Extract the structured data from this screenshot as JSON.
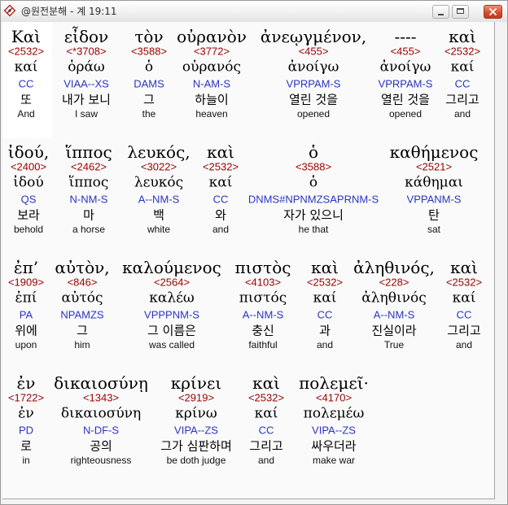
{
  "window": {
    "title": "@원전분해 - 계 19:11",
    "icon": "app-icon",
    "controls": {
      "minimize_icon": "minimize-icon",
      "maximize_icon": "maximize-icon",
      "close_icon": "close-icon"
    }
  },
  "colors": {
    "greek": "#000000",
    "strong": "#9a0000",
    "lemma": "#000000",
    "parse": "#2a35c0",
    "korean": "#000000",
    "english": "#111111",
    "close_button": "#d5492c",
    "selected_word_background": "#ffffff",
    "content_background": "#fafafa"
  },
  "rows": [
    {
      "words": [
        {
          "greek": "Καὶ",
          "strong": "<2532>",
          "lemma": "καί",
          "parse": "CC",
          "korean": "또",
          "english": "And",
          "selected": true
        },
        {
          "greek": "εἶδον",
          "strong": "<*3708>",
          "lemma": "ὁράω",
          "parse": "VIAA--XS",
          "korean": "내가 보니",
          "english": "I saw"
        },
        {
          "greek": "τὸν",
          "strong": "<3588>",
          "lemma": "ὁ",
          "parse": "DAMS",
          "korean": "그",
          "english": "the"
        },
        {
          "greek": "οὐρανὸν",
          "strong": "<3772>",
          "lemma": "οὐρανός",
          "parse": "N-AM-S",
          "korean": "하늘이",
          "english": "heaven"
        },
        {
          "greek": "ἀνεῳγμένον,",
          "strong": "<455>",
          "lemma": "ἀνοίγω",
          "parse": "VPRPAM-S",
          "korean": "열린 것을",
          "english": "opened"
        },
        {
          "greek": "----",
          "strong": "<455>",
          "lemma": "ἀνοίγω",
          "parse": "VPRPAM-S",
          "korean": "열린 것을",
          "english": "opened"
        },
        {
          "greek": "καὶ",
          "strong": "<2532>",
          "lemma": "καί",
          "parse": "CC",
          "korean": "그리고",
          "english": "and"
        }
      ]
    },
    {
      "words": [
        {
          "greek": "ἰδού,",
          "strong": "<2400>",
          "lemma": "ἰδού",
          "parse": "QS",
          "korean": "보라",
          "english": "behold"
        },
        {
          "greek": "ἵππος",
          "strong": "<2462>",
          "lemma": "ἵππος",
          "parse": "N-NM-S",
          "korean": "마",
          "english": "a horse"
        },
        {
          "greek": "λευκός,",
          "strong": "<3022>",
          "lemma": "λευκός",
          "parse": "A--NM-S",
          "korean": "백",
          "english": "white"
        },
        {
          "greek": "καὶ",
          "strong": "<2532>",
          "lemma": "καί",
          "parse": "CC",
          "korean": "와",
          "english": "and"
        },
        {
          "greek": "ὁ",
          "strong": "<3588>",
          "lemma": "ὁ",
          "parse": "DNMS#NPNMZSAPRNM-S",
          "korean": "자가 있으니",
          "english": "he that"
        },
        {
          "greek": "καθήμενος",
          "strong": "<2521>",
          "lemma": "κάθημαι",
          "parse": "VPPANM-S",
          "korean": "탄",
          "english": "sat"
        }
      ]
    },
    {
      "words": [
        {
          "greek": "ἐπ’",
          "strong": "<1909>",
          "lemma": "ἐπί",
          "parse": "PA",
          "korean": "위에",
          "english": "upon"
        },
        {
          "greek": "αὐτὸν,",
          "strong": "<846>",
          "lemma": "αὐτός",
          "parse": "NPAMZS",
          "korean": "그",
          "english": "him"
        },
        {
          "greek": "καλούμενος",
          "strong": "<2564>",
          "lemma": "καλέω",
          "parse": "VPPPNM-S",
          "korean": "그 이름은",
          "english": "was called"
        },
        {
          "greek": "πιστὸς",
          "strong": "<4103>",
          "lemma": "πιστός",
          "parse": "A--NM-S",
          "korean": "충신",
          "english": "faithful"
        },
        {
          "greek": "καὶ",
          "strong": "<2532>",
          "lemma": "καί",
          "parse": "CC",
          "korean": "과",
          "english": "and"
        },
        {
          "greek": "ἀληθινός,",
          "strong": "<228>",
          "lemma": "ἀληθινός",
          "parse": "A--NM-S",
          "korean": "진실이라",
          "english": "True"
        },
        {
          "greek": "καὶ",
          "strong": "<2532>",
          "lemma": "καί",
          "parse": "CC",
          "korean": "그리고",
          "english": "and"
        }
      ]
    },
    {
      "words": [
        {
          "greek": "ἐν",
          "strong": "<1722>",
          "lemma": "ἐν",
          "parse": "PD",
          "korean": "로",
          "english": "in"
        },
        {
          "greek": "δικαιοσύνῃ",
          "strong": "<1343>",
          "lemma": "δικαιοσύνη",
          "parse": "N-DF-S",
          "korean": "공의",
          "english": "righteousness"
        },
        {
          "greek": "κρίνει",
          "strong": "<2919>",
          "lemma": "κρίνω",
          "parse": "VIPA--ZS",
          "korean": "그가 심판하며",
          "english": "be doth judge"
        },
        {
          "greek": "καὶ",
          "strong": "<2532>",
          "lemma": "καί",
          "parse": "CC",
          "korean": "그리고",
          "english": "and"
        },
        {
          "greek": "πολεμεῖ·",
          "strong": "<4170>",
          "lemma": "πολεμέω",
          "parse": "VIPA--ZS",
          "korean": "싸우더라",
          "english": "make war"
        }
      ]
    }
  ]
}
